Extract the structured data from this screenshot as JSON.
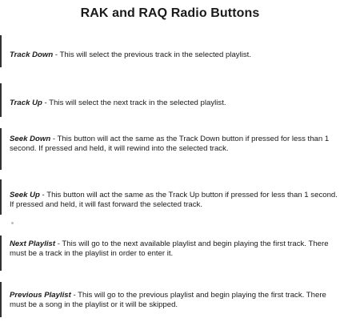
{
  "document": {
    "title": "RAK and RAQ Radio Buttons",
    "entries": [
      {
        "name": "Track Down",
        "description": " - This will select the previous track in the selected playlist."
      },
      {
        "name": "Track Up",
        "description": " - This will select the next track in the selected playlist."
      },
      {
        "name": "Seek Down",
        "description": " -  This button will act the same as the Track Down button if pressed for less than 1 second. If pressed and held, it will rewind into the selected track."
      },
      {
        "name": "Seek Up",
        "description": " -  This button will act the same as the Track Up button if pressed for less than 1 second. If pressed and held, it will fast forward the selected track."
      },
      {
        "name": "Next Playlist",
        "description": " - This will go to the next available playlist and begin playing the first track. There must be a track in the playlist in order to enter it."
      },
      {
        "name": "Previous Playlist",
        "description": " - This will go to the previous playlist and begin playing the first track. There must be a song in the playlist or it will be skipped."
      }
    ]
  }
}
